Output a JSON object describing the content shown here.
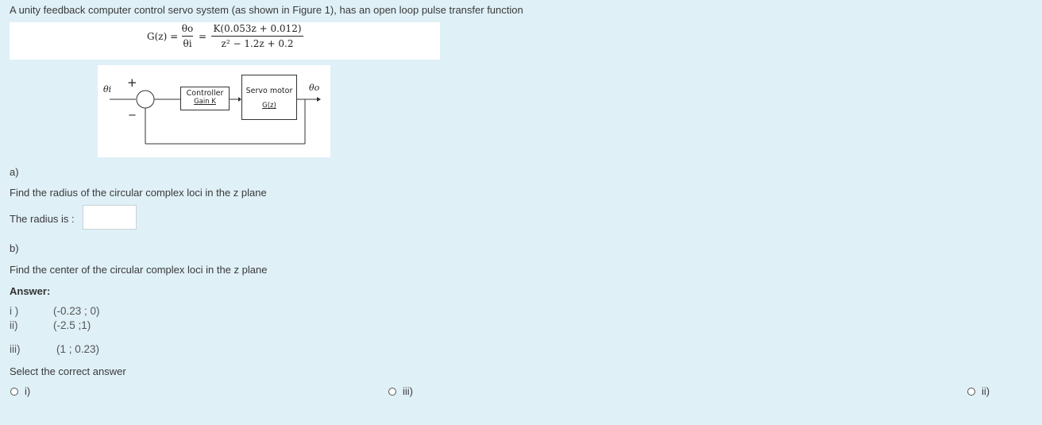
{
  "question_intro": "A unity feedback computer control servo system (as shown in Figure 1), has an open loop pulse transfer function",
  "formula": {
    "lhs": "G(z) =",
    "frac1_num": "θo",
    "frac1_den": "θi",
    "equals": "=",
    "frac2_num": "K(0.053z + 0.012)",
    "frac2_den": "z² − 1.2z + 0.2"
  },
  "diagram": {
    "input_label": "θi",
    "plus_sign": "+",
    "minus_sign": "−",
    "controller_title": "Controller",
    "controller_sub": "Gain  K",
    "servo_title": "Servo motor",
    "servo_sub": "G(z)",
    "output_label": "θo"
  },
  "part_a": {
    "label": "a)",
    "question": "Find the radius of the circular complex loci in the z plane",
    "radius_label": "The radius is :",
    "radius_value": ""
  },
  "part_b": {
    "label": "b)",
    "question": "Find the center of the circular complex loci in the z plane",
    "answer_heading": "Answer:",
    "choices": [
      {
        "num": "i )",
        "value": "(-0.23 ; 0)"
      },
      {
        "num": "ii)",
        "value": "(-2.5 ;1)"
      },
      {
        "num": "iii)",
        "value": "(1 ; 0.23)"
      }
    ],
    "select_prompt": "Select the correct answer",
    "options": [
      {
        "label": "i)"
      },
      {
        "label": "iii)"
      },
      {
        "label": "ii)"
      }
    ]
  }
}
